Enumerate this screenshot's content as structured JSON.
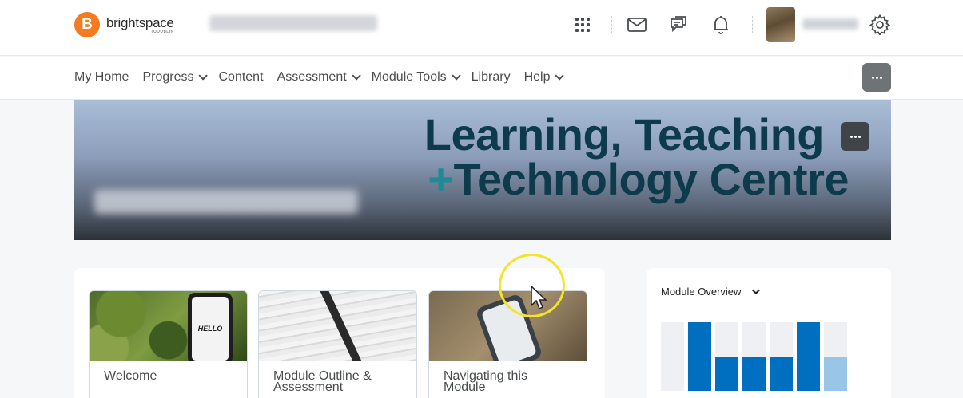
{
  "header": {
    "logo_word": "brightspace",
    "logo_sub": "TUDUBLIN",
    "logo_letter": "B",
    "icons": [
      "apps-grid-icon",
      "mail-icon",
      "chat-icon",
      "bell-icon",
      "gear-icon"
    ]
  },
  "nav": {
    "items": [
      {
        "label": "My Home",
        "dropdown": false
      },
      {
        "label": "Progress",
        "dropdown": true
      },
      {
        "label": "Content",
        "dropdown": false
      },
      {
        "label": "Assessment",
        "dropdown": true
      },
      {
        "label": "Module Tools",
        "dropdown": true
      },
      {
        "label": "Library",
        "dropdown": false
      },
      {
        "label": "Help",
        "dropdown": true
      }
    ]
  },
  "banner": {
    "line1": "Learning, Teaching",
    "line2_plus": "+",
    "line2": "Technology Centre"
  },
  "cards": [
    {
      "title": "Welcome",
      "image_text": "HELLO"
    },
    {
      "title": "Module Outline & Assessment"
    },
    {
      "title": "Navigating this Module"
    }
  ],
  "overview": {
    "title": "Module Overview",
    "bars": [
      {
        "value": 0,
        "color": "#eef0f3"
      },
      {
        "value": 1.0,
        "color": "#006fbf"
      },
      {
        "value": 0.5,
        "color": "#006fbf"
      },
      {
        "value": 0.5,
        "color": "#006fbf"
      },
      {
        "value": 0.5,
        "color": "#006fbf"
      },
      {
        "value": 1.0,
        "color": "#006fbf"
      },
      {
        "value": 0.5,
        "color": "#99c5e6"
      }
    ]
  },
  "colors": {
    "accent": "#006fbf",
    "logo_orange": "#f47b20",
    "highlight": "#f2e42a"
  }
}
